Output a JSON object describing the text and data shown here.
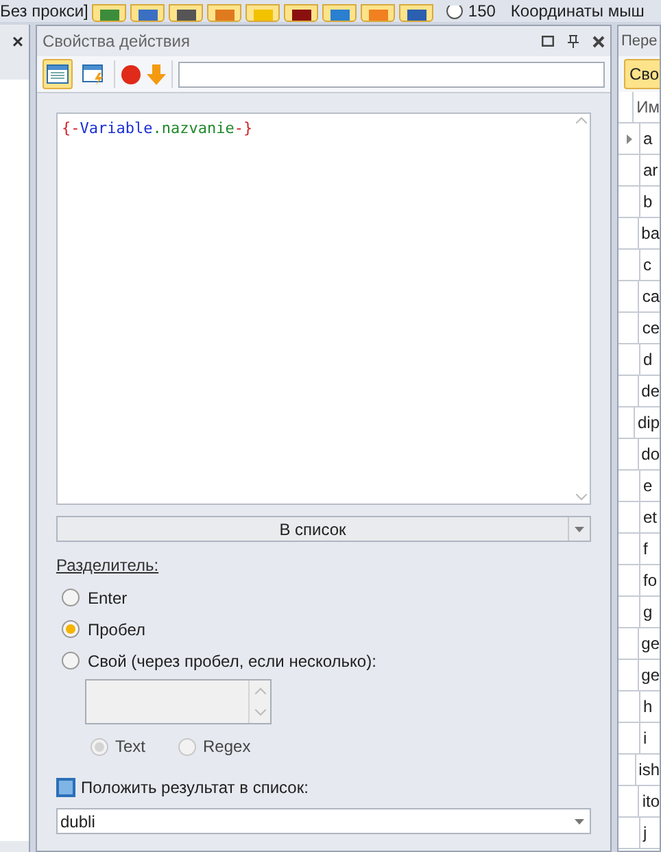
{
  "top_bar": {
    "proxy": "Без прокси]",
    "counter": "150",
    "mouse_coords": "Координаты мыш"
  },
  "left_panel": {
    "close": "×"
  },
  "panel": {
    "title": "Свойства действия",
    "toolbar": [
      {
        "selected": true
      },
      {
        "selected": false
      }
    ],
    "editor": [
      {
        "kind": "brace",
        "text": "{-"
      },
      {
        "kind": "variable",
        "text": "Variable"
      },
      {
        "kind": "name",
        "text": ".nazvanie"
      },
      {
        "kind": "brace",
        "text": "-}"
      }
    ],
    "mode": "В список",
    "separator_label": "Разделитель:",
    "options": [
      {
        "label": "Enter",
        "selected": false
      },
      {
        "label": "Пробел",
        "selected": true
      },
      {
        "label": "Свой (через пробел, если несколько):",
        "selected": false
      }
    ],
    "sub_options": [
      {
        "label": "Text",
        "selected": true
      },
      {
        "label": "Regex",
        "selected": false
      }
    ],
    "save_label": "Положить результат в список:",
    "save_list": "dubli"
  },
  "right_panel": {
    "title": "Пере",
    "button": "Сво",
    "column": "Им",
    "rows": [
      {
        "name": "a",
        "selected": true
      },
      {
        "name": "ar",
        "selected": false
      },
      {
        "name": "b",
        "selected": false
      },
      {
        "name": "ba",
        "selected": false
      },
      {
        "name": "c",
        "selected": false
      },
      {
        "name": "ca",
        "selected": false
      },
      {
        "name": "ce",
        "selected": false
      },
      {
        "name": "d",
        "selected": false
      },
      {
        "name": "de",
        "selected": false
      },
      {
        "name": "dip",
        "selected": false
      },
      {
        "name": "do",
        "selected": false
      },
      {
        "name": "e",
        "selected": false
      },
      {
        "name": "et",
        "selected": false
      },
      {
        "name": "f",
        "selected": false
      },
      {
        "name": "fo",
        "selected": false
      },
      {
        "name": "g",
        "selected": false
      },
      {
        "name": "ge",
        "selected": false
      },
      {
        "name": "ge",
        "selected": false
      },
      {
        "name": "h",
        "selected": false
      },
      {
        "name": "i",
        "selected": false
      },
      {
        "name": "ish",
        "selected": false
      },
      {
        "name": "ito",
        "selected": false
      },
      {
        "name": "j",
        "selected": false
      }
    ]
  }
}
